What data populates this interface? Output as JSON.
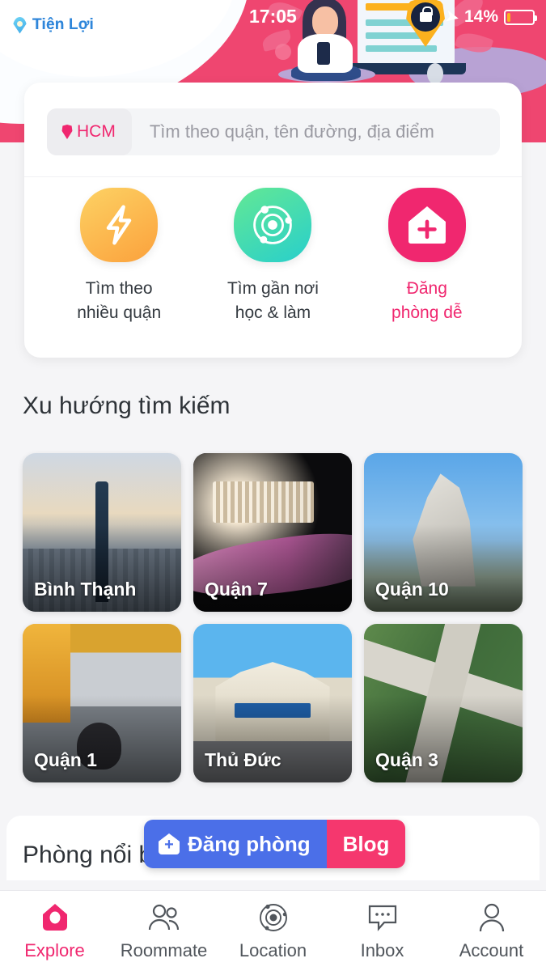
{
  "statusbar": {
    "time": "17:05",
    "lock_icon": "lock-icon",
    "nav_arrow_icon": "navigation-arrow-icon",
    "battery_percent": "14%",
    "battery_level": 14
  },
  "brand": {
    "name": "Tiện Lợi",
    "pin_icon": "map-pin-icon",
    "accent": "#2f86da"
  },
  "hero": {
    "background": "#ef4670",
    "illustration": "person-with-phone-illustration"
  },
  "search": {
    "city": "HCM",
    "city_pin_icon": "location-pin-icon",
    "placeholder": "Tìm theo quận, tên đường, địa điểm",
    "value": ""
  },
  "quick_actions": [
    {
      "label_line1": "Tìm theo",
      "label_line2": "nhiều quận",
      "icon": "lightning-bolt-icon",
      "color_from": "#fdd264",
      "color_to": "#fba13c",
      "highlight": false
    },
    {
      "label_line1": "Tìm gần nơi",
      "label_line2": "học & làm",
      "icon": "orbit-target-icon",
      "color_from": "#63e894",
      "color_to": "#28cfcc",
      "highlight": false
    },
    {
      "label_line1": "Đăng",
      "label_line2": "phòng dễ",
      "icon": "house-plus-icon",
      "color_from": "#f0276f",
      "color_to": "#f0276f",
      "highlight": true
    }
  ],
  "trending": {
    "title": "Xu hướng tìm kiếm",
    "cards": [
      {
        "label": "Bình Thạnh",
        "art": "art-binhthanh"
      },
      {
        "label": "Quận 7",
        "art": "art-quan7"
      },
      {
        "label": "Quận 10",
        "art": "art-quan10"
      },
      {
        "label": "Quận 1",
        "art": "art-quan1"
      },
      {
        "label": "Thủ Đức",
        "art": "art-thuduc"
      },
      {
        "label": "Quận 3",
        "art": "art-quan3"
      }
    ]
  },
  "featured": {
    "title": "Phòng nổi bật"
  },
  "floating_buttons": {
    "post_label": "Đăng phòng",
    "post_icon": "house-plus-icon",
    "post_color": "#4b6fe8",
    "blog_label": "Blog",
    "blog_color": "#f5376e"
  },
  "bottom_nav": {
    "active_color": "#f0276f",
    "items": [
      {
        "label": "Explore",
        "icon": "house-home-icon",
        "active": true
      },
      {
        "label": "Roommate",
        "icon": "people-group-icon",
        "active": false
      },
      {
        "label": "Location",
        "icon": "orbit-target-icon",
        "active": false
      },
      {
        "label": "Inbox",
        "icon": "chat-bubble-icon",
        "active": false
      },
      {
        "label": "Account",
        "icon": "user-person-icon",
        "active": false
      }
    ]
  }
}
